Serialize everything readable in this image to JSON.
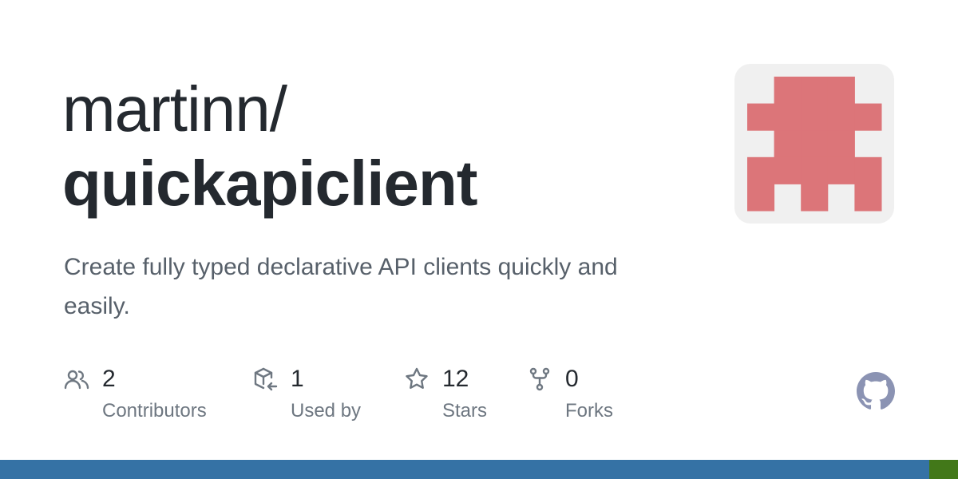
{
  "repo": {
    "owner": "martinn/",
    "name": "quickapiclient",
    "description": "Create fully typed declarative API clients quickly and easily."
  },
  "avatar": {
    "icon": "identicon",
    "color": "#dc7579",
    "background": "#f0f0f0",
    "grid": [
      [
        0,
        1,
        1,
        1,
        0
      ],
      [
        1,
        1,
        1,
        1,
        1
      ],
      [
        0,
        1,
        1,
        1,
        0
      ],
      [
        1,
        1,
        1,
        1,
        1
      ],
      [
        1,
        0,
        1,
        0,
        1
      ]
    ]
  },
  "stats": [
    {
      "icon": "people-icon",
      "value": "2",
      "label": "Contributors"
    },
    {
      "icon": "package-dependents-icon",
      "value": "1",
      "label": "Used by"
    },
    {
      "icon": "star-icon",
      "value": "12",
      "label": "Stars"
    },
    {
      "icon": "repo-forked-icon",
      "value": "0",
      "label": "Forks"
    }
  ],
  "brand": {
    "icon": "github-mark-icon",
    "color": "#8b93b3"
  },
  "language_bar": [
    {
      "color": "#3572a5",
      "percent": 97
    },
    {
      "color": "#427819",
      "percent": 3
    }
  ]
}
